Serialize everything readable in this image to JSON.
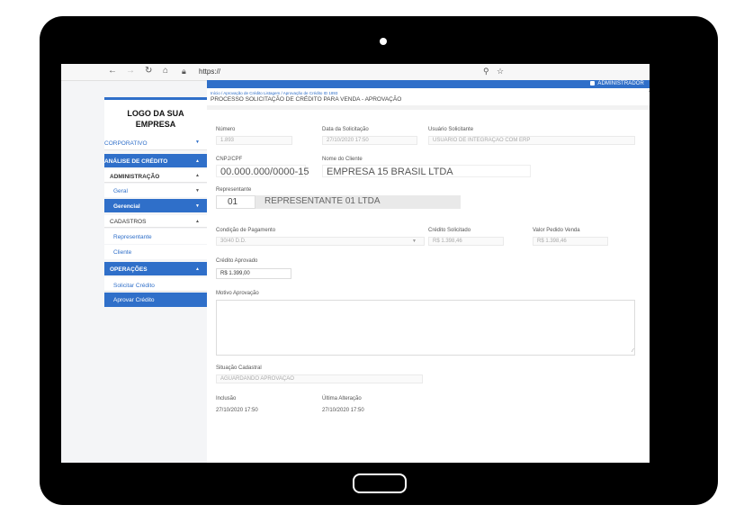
{
  "browser": {
    "back_icon": "back-arrow-icon",
    "forward_icon": "forward-arrow-icon",
    "reload_icon": "reload-icon",
    "home_icon": "home-icon",
    "lock_icon": "lock-icon",
    "url": "https://",
    "search_icon": "search-icon",
    "star_icon": "star-icon"
  },
  "topbar": {
    "user": "ADMINISTRADOR"
  },
  "logo": {
    "line1": "LOGO DA SUA",
    "line2": "EMPRESA"
  },
  "sidebar": {
    "corporativo": "CORPORATIVO",
    "analise": "ANÁLISE DE CRÉDITO",
    "administracao": "ADMINISTRAÇÃO",
    "geral": "Geral",
    "gerencial": "Gerencial",
    "cadastros": "CADASTROS",
    "representante": "Representante",
    "cliente": "Cliente",
    "operacoes": "OPERAÇÕES",
    "solicitar": "Solicitar Crédito",
    "aprovar": "Aprovar Crédito"
  },
  "main": {
    "breadcrumb": "Início  /  Aprovação de Crédito Listagem  /  Aprovação de Crédito ID 1893",
    "title": "PROCESSO SOLICITAÇÃO DE CRÉDITO PARA VENDA - APROVAÇÃO",
    "numero_label": "Número",
    "numero": "1.893",
    "data_label": "Data da Solicitação",
    "data": "27/10/2020 17:50",
    "usuario_label": "Usuário Solicitante",
    "usuario": "USUÁRIO DE INTEGRAÇÃO COM ERP",
    "cnpj_label": "CNPJ/CPF",
    "cnpj": "00.000.000/0000-15",
    "cliente_label": "Nome do Cliente",
    "cliente": "EMPRESA 15 BRASIL LTDA",
    "rep_label": "Representante",
    "rep_code": "01",
    "rep_name": "REPRESENTANTE 01 LTDA",
    "cond_label": "Condição de Pagamento",
    "cond": "30/40 D.D.",
    "cred_sol_label": "Crédito Solicitado",
    "cred_sol": "R$ 1.398,46",
    "valor_label": "Valor Pedido Venda",
    "valor": "R$ 1.398,46",
    "cred_apr_label": "Crédito Aprovado",
    "cred_apr": "R$ 1.399,00",
    "motivo_label": "Motivo Aprovação",
    "situacao_label": "Situação Cadastral",
    "situacao": "AGUARDANDO APROVAÇÃO",
    "inclusao_label": "Inclusão",
    "inclusao": "27/10/2020 17:50",
    "alteracao_label": "Última Alteração",
    "alteracao": "27/10/2020 17:50"
  }
}
